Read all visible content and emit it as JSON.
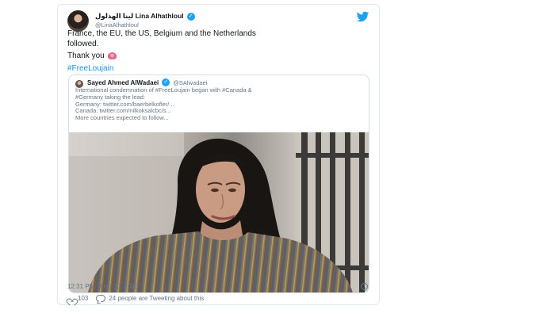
{
  "tweet": {
    "author_name": "لينا الهذلول Lina Alhathloul",
    "author_handle": "@LinaAlhathloul",
    "text_lines": [
      "France, the EU, the US, Belgium and the Netherlands",
      "followed."
    ],
    "thanks_text": "Thank you",
    "emoji_name": "rose-icon",
    "hashtag": "#FreeLoujain",
    "timestamp": "12:31 PM - Dec 30, 2020",
    "likes_count": "103",
    "tweeting_text": "24 people are Tweeting about this"
  },
  "quote_tweet": {
    "author_name": "Sayed Ahmed AlWadaei",
    "author_handle": "@SAlwadaei",
    "text_lines": [
      "International condemnation of #FreeLoujain began with #Canada &",
      "#Germany taking the lead:",
      "Germany: twitter.com/baerbelkofler/...",
      "Canada: twitter.com/nilkoksalcbc/s...",
      "More countries expected to follow..."
    ]
  },
  "icons": {
    "twitter_logo": "twitter-logo-icon",
    "verified_badge": "verified-icon",
    "info": "info-icon",
    "like": "heart-icon",
    "reply": "bubble-icon"
  },
  "colors": {
    "link_blue": "#1b95e0",
    "verified_blue": "#1da1f2",
    "muted_text": "#657786"
  }
}
